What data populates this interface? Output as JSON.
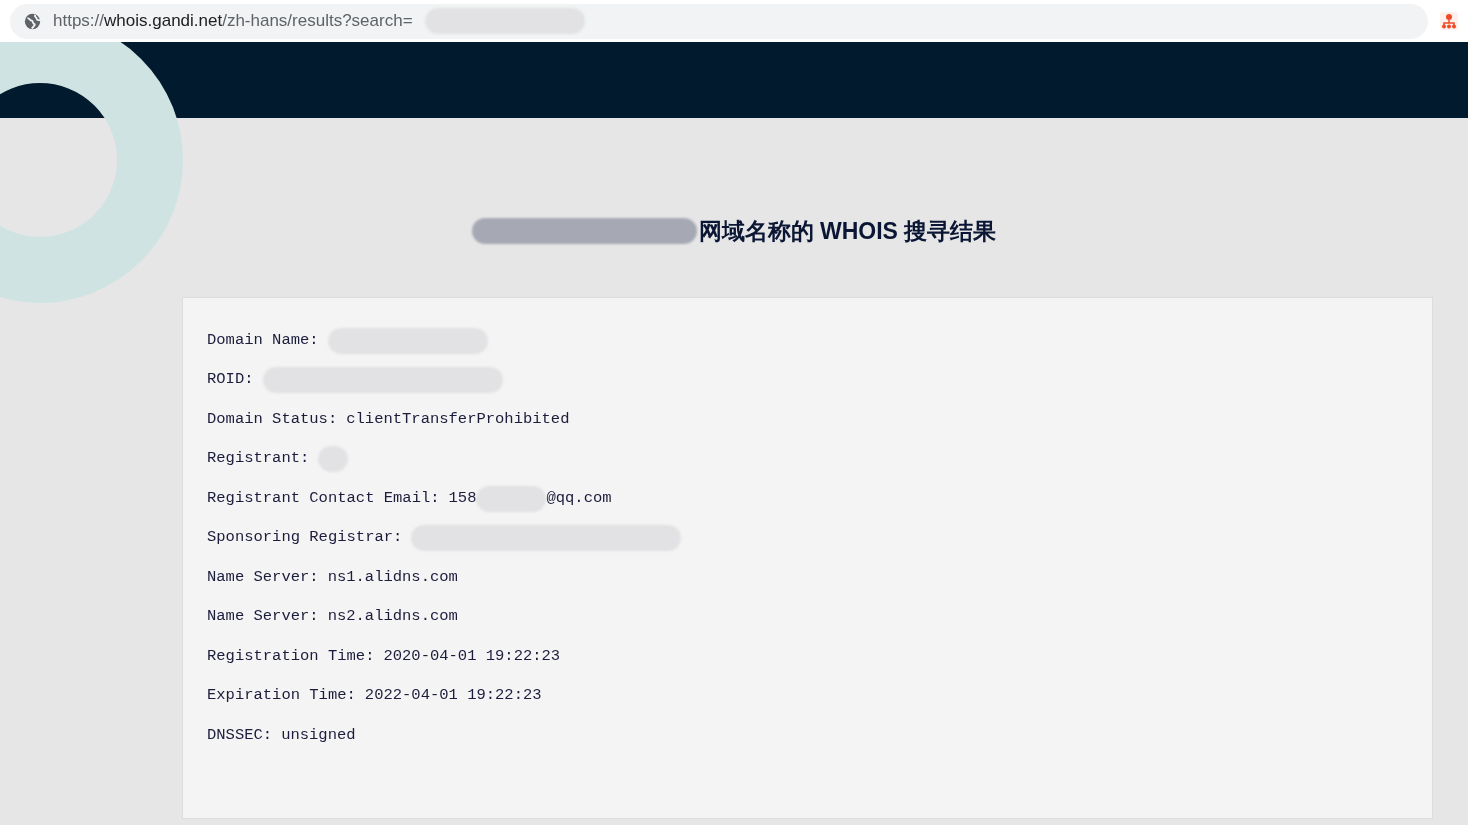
{
  "address_bar": {
    "scheme": "https://",
    "host": "whois.gandi.net",
    "path": "/zh-hans/results?search="
  },
  "heading": "网域名称的 WHOIS 搜寻结果",
  "records": [
    {
      "label": "Domain Name:",
      "parts": [
        {
          "kind": "redacted"
        }
      ]
    },
    {
      "label": "ROID:",
      "parts": [
        {
          "kind": "redacted"
        }
      ]
    },
    {
      "label": "Domain Status:",
      "parts": [
        {
          "kind": "text",
          "text": "clientTransferProhibited"
        }
      ]
    },
    {
      "label": "Registrant:",
      "parts": [
        {
          "kind": "redacted"
        }
      ]
    },
    {
      "label": "Registrant Contact Email:",
      "parts": [
        {
          "kind": "text",
          "text": "158"
        },
        {
          "kind": "redacted"
        },
        {
          "kind": "text",
          "text": "@qq.com"
        }
      ]
    },
    {
      "label": "Sponsoring Registrar:",
      "parts": [
        {
          "kind": "redacted"
        }
      ]
    },
    {
      "label": "Name Server:",
      "parts": [
        {
          "kind": "text",
          "text": "ns1.alidns.com"
        }
      ]
    },
    {
      "label": "Name Server:",
      "parts": [
        {
          "kind": "text",
          "text": "ns2.alidns.com"
        }
      ]
    },
    {
      "label": "Registration Time:",
      "parts": [
        {
          "kind": "text",
          "text": "2020-04-01 19:22:23"
        }
      ]
    },
    {
      "label": "Expiration Time:",
      "parts": [
        {
          "kind": "text",
          "text": "2022-04-01 19:22:23"
        }
      ]
    },
    {
      "label": "DNSSEC:",
      "parts": [
        {
          "kind": "text",
          "text": "unsigned"
        }
      ]
    }
  ]
}
